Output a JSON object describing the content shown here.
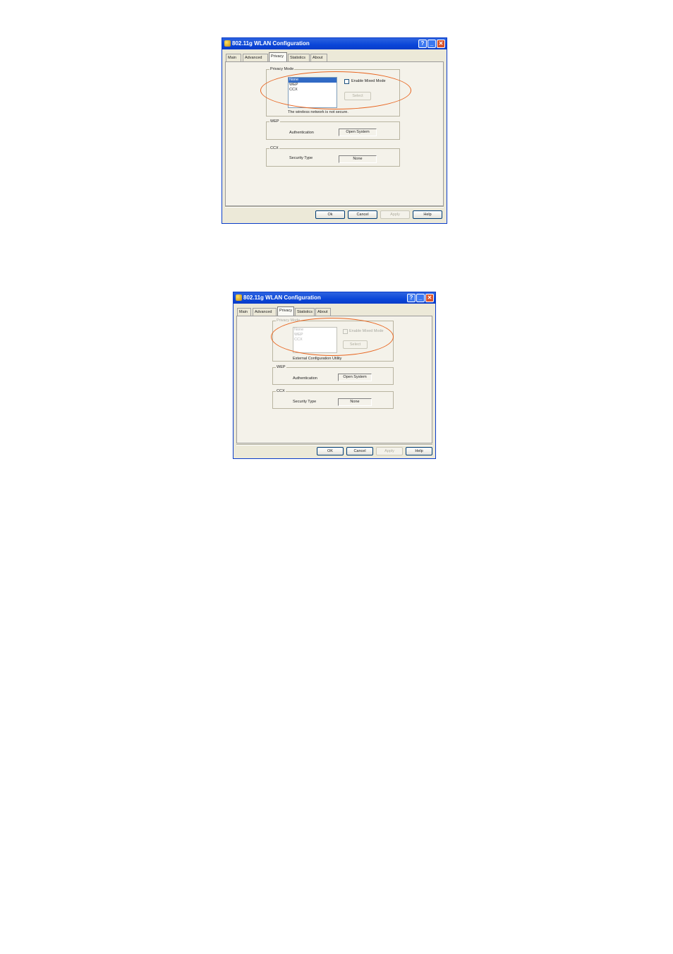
{
  "accent_color": "#e8641e",
  "windows": [
    {
      "title": "802.11g WLAN Configuration",
      "tabs": [
        "Main",
        "Advanced",
        "Privacy",
        "Statistics",
        "About"
      ],
      "active_tab": "Privacy",
      "privacy_mode": {
        "label": "Privacy Mode",
        "options": [
          "None",
          "WEP",
          "CCX"
        ],
        "selected": "None",
        "mixed_mode_label": "Enable Mixed Mode",
        "select_button": "Select",
        "status_text": "The wireless network is not secure."
      },
      "wep": {
        "label": "WEP",
        "auth_label": "Authentication",
        "auth_value": "Open System"
      },
      "ccx": {
        "label": "CCX",
        "security_label": "Security Type",
        "security_value": "None"
      },
      "buttons": {
        "ok": "Ok",
        "cancel": "Cancel",
        "apply": "Apply",
        "help": "Help"
      }
    },
    {
      "title": "802.11g WLAN Configuration",
      "tabs": [
        "Main",
        "Advanced",
        "Privacy",
        "Statistics",
        "About"
      ],
      "active_tab": "Privacy",
      "privacy_mode": {
        "label": "Privacy Mode",
        "options": [
          "None",
          "WEP",
          "CCX"
        ],
        "mixed_mode_label": "Enable Mixed Mode",
        "select_button": "Select",
        "status_text": "External Configuration Utility"
      },
      "wep": {
        "label": "WEP",
        "auth_label": "Authentication",
        "auth_value": "Open System"
      },
      "ccx": {
        "label": "CCX",
        "security_label": "Security Type",
        "security_value": "None"
      },
      "buttons": {
        "ok": "OK",
        "cancel": "Cancel",
        "apply": "Apply",
        "help": "Help"
      }
    }
  ]
}
